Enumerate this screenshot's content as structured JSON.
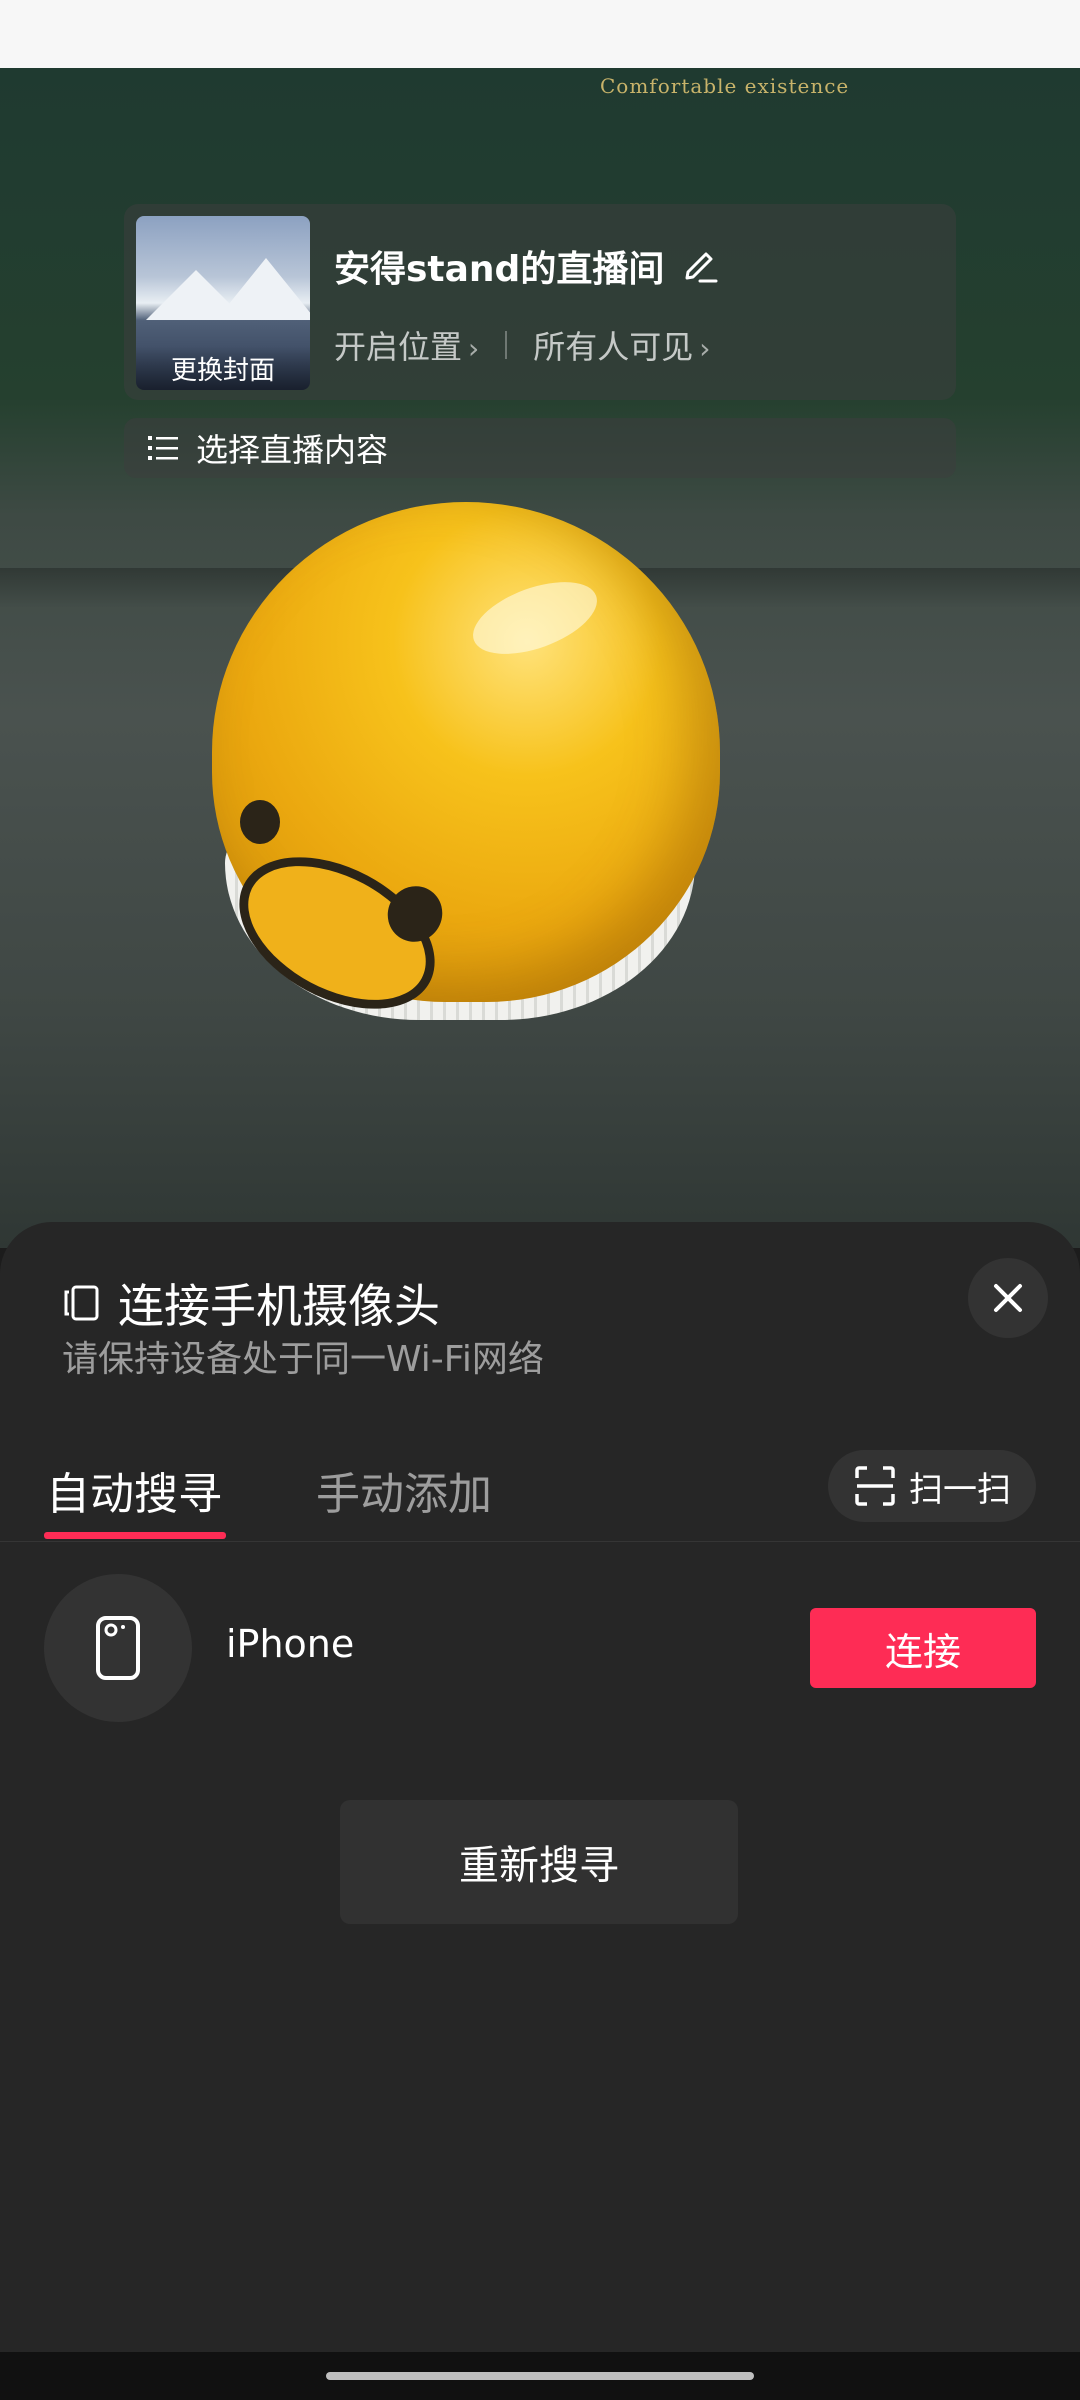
{
  "preview": {
    "wall_text": "Comfortable existence"
  },
  "live_card": {
    "cover_label": "更换封面",
    "room_title": "安得stand的直播间",
    "location": "开启位置",
    "visibility": "所有人可见",
    "select_content": "选择直播内容"
  },
  "sheet": {
    "title": "连接手机摄像头",
    "subtitle": "请保持设备处于同一Wi-Fi网络",
    "tabs": [
      {
        "label": "自动搜寻",
        "active": true
      },
      {
        "label": "手动添加",
        "active": false
      }
    ],
    "scan_label": "扫一扫",
    "device": {
      "name": "iPhone",
      "connect_label": "连接"
    },
    "research_label": "重新搜寻"
  },
  "colors": {
    "accent": "#fe2c55",
    "sheet_bg": "#262626"
  },
  "icons": [
    "edit-icon",
    "chevron-right-icon",
    "list-icon",
    "phone-camera-icon",
    "close-icon",
    "scan-icon",
    "phone-icon"
  ]
}
